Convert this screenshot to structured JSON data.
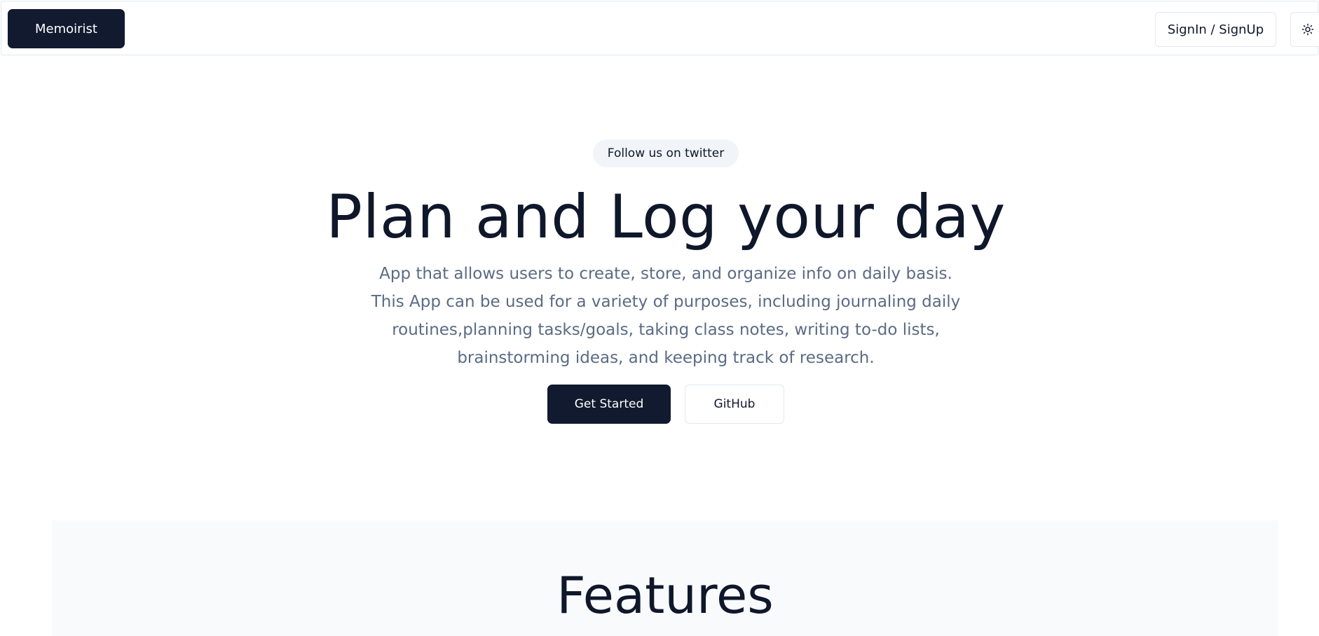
{
  "nav": {
    "brand": "Memoirist",
    "signin_label": "SignIn / SignUp",
    "theme_icon": "sun-icon"
  },
  "hero": {
    "badge": "Follow us on twitter",
    "title": "Plan and Log your day",
    "description": "App that allows users to create, store, and organize info on daily basis. This App can be used for a variety of purposes, including journaling daily routines,planning tasks/goals, taking class notes, writing to-do lists, brainstorming ideas, and keeping track of research.",
    "primary_button": "Get Started",
    "secondary_button": "GitHub"
  },
  "features": {
    "title": "Features"
  },
  "colors": {
    "primary": "#111a2e",
    "border": "#e2e8f0",
    "muted_text": "#5b6b84",
    "pill_bg": "#f1f5f9",
    "section_bg": "#f8fafc"
  }
}
